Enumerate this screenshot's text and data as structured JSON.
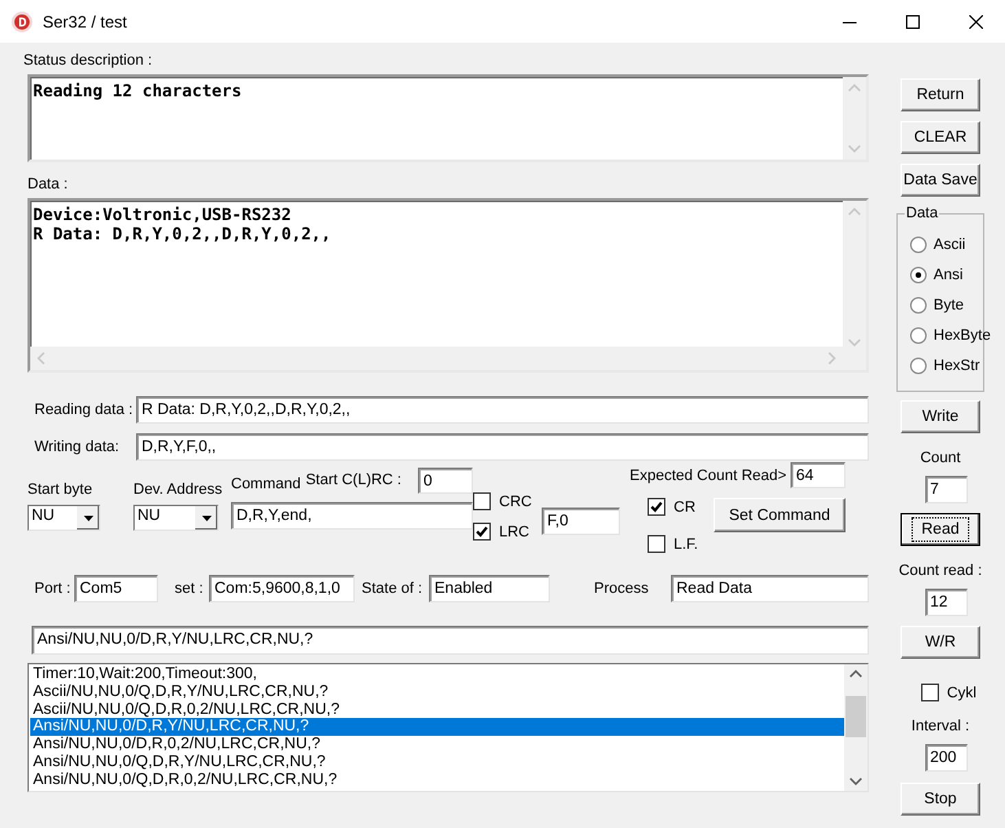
{
  "window": {
    "title": "Ser32 / test"
  },
  "status": {
    "label": "Status description :",
    "text": "Reading 12 characters"
  },
  "data": {
    "label": "Data :",
    "lines": [
      "Device:Voltronic,USB-RS232",
      "R Data: D,R,Y,0,2,,D,R,Y,0,2,,"
    ]
  },
  "reading": {
    "label": "Reading data :",
    "value": "R Data: D,R,Y,0,2,,D,R,Y,0,2,,"
  },
  "writing": {
    "label": "Writing data:",
    "value": "D,R,Y,F,0,,"
  },
  "start_byte": {
    "label": "Start byte",
    "value": "NU"
  },
  "dev_address": {
    "label": "Dev. Address",
    "value": "NU"
  },
  "command": {
    "label": "Command",
    "value": "D,R,Y,end,"
  },
  "start_crc": {
    "label": "Start C(L)RC :",
    "value": "0"
  },
  "checks": [
    {
      "label": "CRC",
      "checked": false
    },
    {
      "label": "LRC",
      "checked": true
    }
  ],
  "check_field": {
    "value": "F,0"
  },
  "expected_count": {
    "label": "Expected Count Read>",
    "value": "64"
  },
  "endings": [
    {
      "label": "CR",
      "checked": true
    },
    {
      "label": "L.F.",
      "checked": false
    }
  ],
  "set_command": "Set Command",
  "port_row": [
    {
      "label": "Port :",
      "value": "Com5"
    },
    {
      "label": "set :",
      "value": "Com:5,9600,8,1,0"
    },
    {
      "label": "State of :",
      "value": "Enabled"
    },
    {
      "label": "Process",
      "value": "Read Data"
    }
  ],
  "command_line": "Ansi/NU,NU,0/D,R,Y/NU,LRC,CR,NU,?",
  "log": [
    {
      "text": "Timer:10,Wait:200,Timeout:300,",
      "selected": false
    },
    {
      "text": "Ascii/NU,NU,0/Q,D,R,Y/NU,LRC,CR,NU,?",
      "selected": false
    },
    {
      "text": "Ascii/NU,NU,0/Q,D,R,0,2/NU,LRC,CR,NU,?",
      "selected": false
    },
    {
      "text": "Ansi/NU,NU,0/D,R,Y/NU,LRC,CR,NU,?",
      "selected": true
    },
    {
      "text": "Ansi/NU,NU,0/D,R,0,2/NU,LRC,CR,NU,?",
      "selected": false
    },
    {
      "text": "Ansi/NU,NU,0/Q,D,R,Y/NU,LRC,CR,NU,?",
      "selected": false
    },
    {
      "text": "Ansi/NU,NU,0/Q,D,R,0,2/NU,LRC,CR,NU,?",
      "selected": false
    }
  ],
  "side_buttons": [
    "Return",
    "CLEAR",
    "Data Save"
  ],
  "data_format": {
    "label": "Data",
    "options": [
      {
        "label": "Ascii",
        "selected": false
      },
      {
        "label": "Ansi",
        "selected": true
      },
      {
        "label": "Byte",
        "selected": false
      },
      {
        "label": "HexByte",
        "selected": false
      },
      {
        "label": "HexStr",
        "selected": false
      }
    ]
  },
  "write_button": "Write",
  "count": {
    "label": "Count",
    "value": "7"
  },
  "read_button": {
    "label": "Read",
    "focused": true
  },
  "count_read": {
    "label": "Count read :",
    "value": "12"
  },
  "wr_button": "W/R",
  "cykl": {
    "label": "Cykl",
    "checked": false
  },
  "interval": {
    "label": "Interval :",
    "value": "200"
  },
  "stop_button": "Stop"
}
